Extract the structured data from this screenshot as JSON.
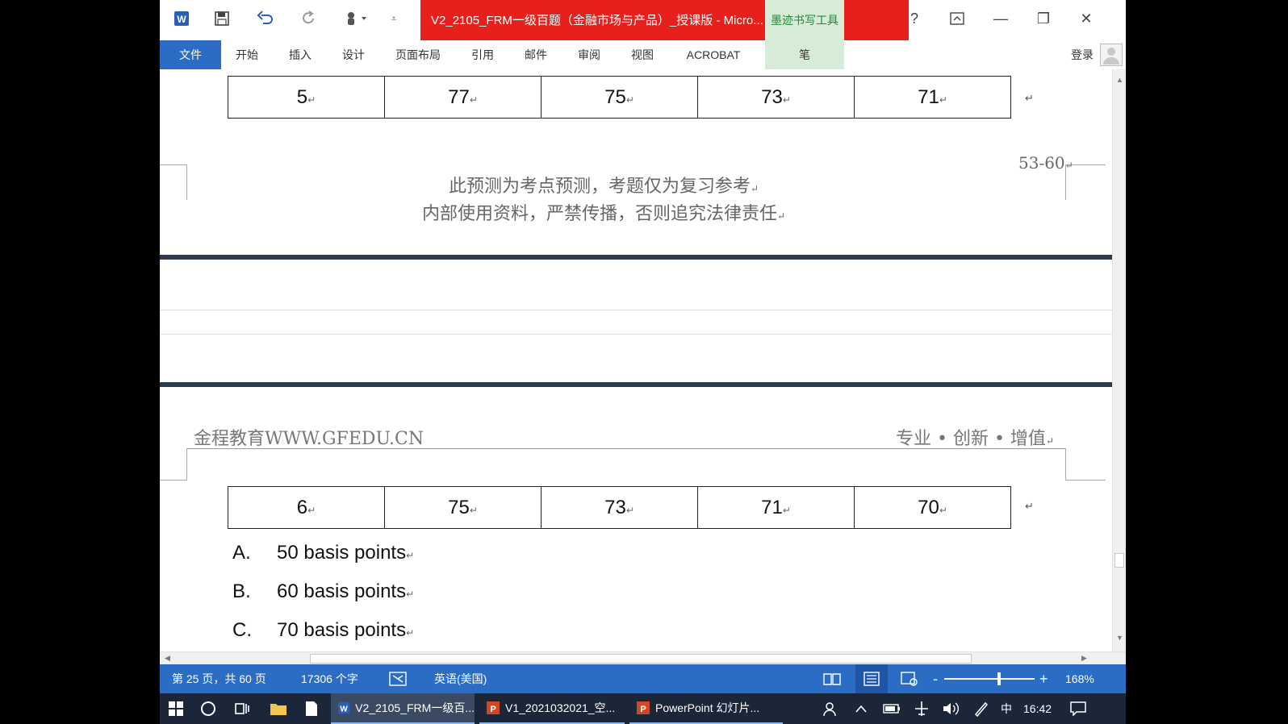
{
  "window": {
    "title": "V2_2105_FRM一级百题（金融市场与产品）_授课版 - Micro...",
    "context_tab": "墨迹书写工具",
    "help": "?",
    "controls": {
      "ribbon_display": "⌂",
      "minimize": "—",
      "restore": "❐",
      "close": "✕"
    }
  },
  "ribbon": {
    "tabs": [
      "文件",
      "开始",
      "插入",
      "设计",
      "页面布局",
      "引用",
      "邮件",
      "审阅",
      "视图",
      "ACROBAT",
      "笔"
    ],
    "login": "登录"
  },
  "document": {
    "row5": [
      "5",
      "77",
      "75",
      "73",
      "71"
    ],
    "page_range": "53-60",
    "disclaimer_line1": "此预测为考点预测，考题仅为复习参考",
    "disclaimer_line2": "内部使用资料，严禁传播，否则追究法律责任",
    "header_left": "金程教育WWW.GFEDU.CN",
    "header_right": "专业 • 创新 • 增值",
    "row6": [
      "6",
      "75",
      "73",
      "71",
      "70"
    ],
    "options": [
      {
        "letter": "A.",
        "text": "50 basis points"
      },
      {
        "letter": "B.",
        "text": "60 basis points"
      },
      {
        "letter": "C.",
        "text": "70 basis points"
      }
    ],
    "para_mark": "↵"
  },
  "statusbar": {
    "page": "第 25 页，共 60 页",
    "words": "17306 个字",
    "language": "英语(美国)",
    "zoom_minus": "-",
    "zoom_plus": "+",
    "zoom": "168%"
  },
  "taskbar": {
    "tasks": [
      {
        "label": "V2_2105_FRM一级百..."
      },
      {
        "label": "V1_2021032021_空..."
      },
      {
        "label": "PowerPoint 幻灯片..."
      }
    ],
    "ime": "中",
    "time": "16:42"
  },
  "colors": {
    "title_red": "#e8201b",
    "ribbon_blue": "#2b6cc4",
    "ink_green": "#d7ecd7",
    "taskbar": "#1b2638"
  }
}
